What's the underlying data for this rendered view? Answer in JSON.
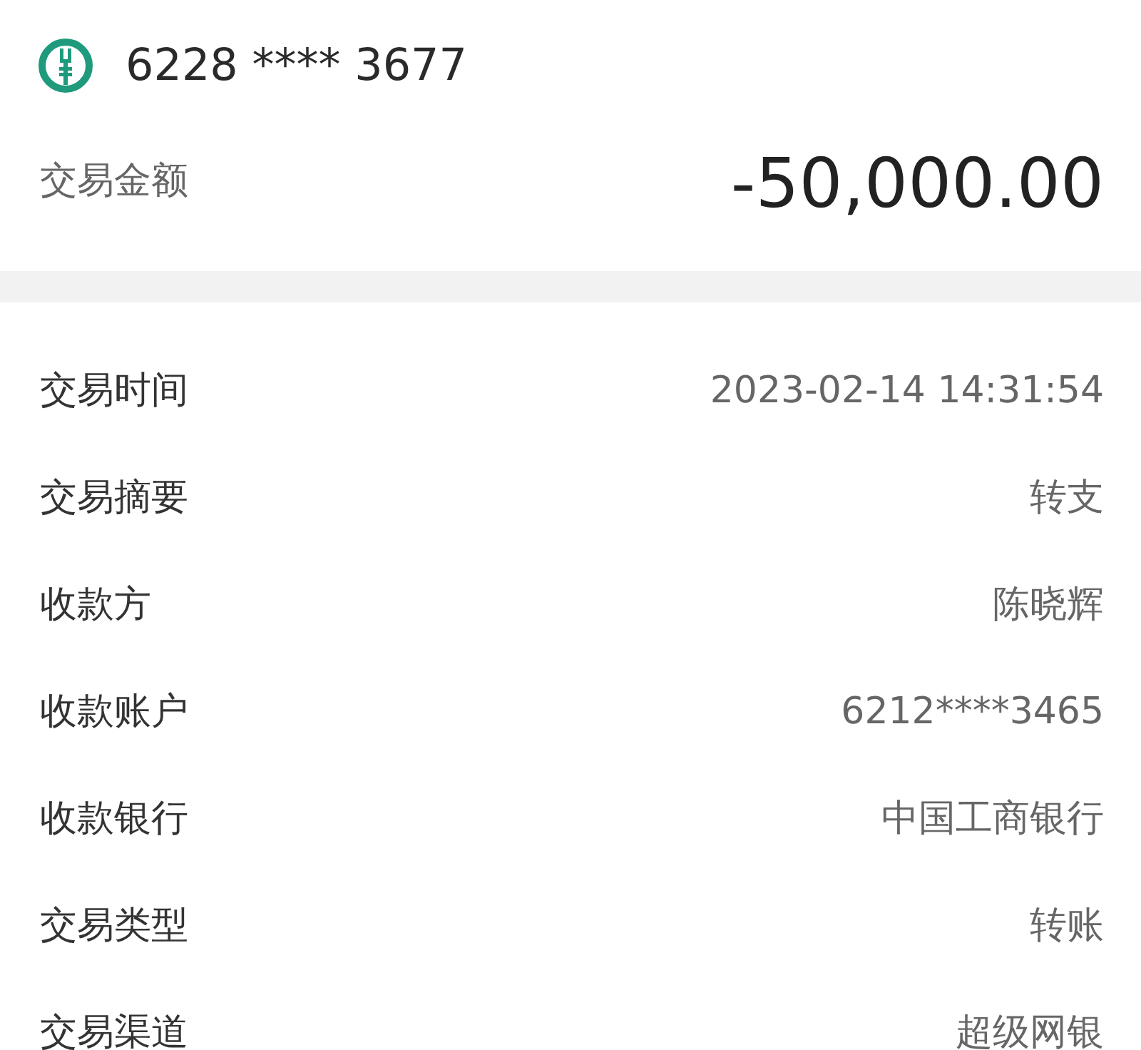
{
  "account": {
    "card_number": "6228 **** 3677"
  },
  "amount": {
    "label": "交易金额",
    "value": "-50,000.00"
  },
  "details": [
    {
      "label": "交易时间",
      "value": "2023-02-14 14:31:54"
    },
    {
      "label": "交易摘要",
      "value": "转支"
    },
    {
      "label": "收款方",
      "value": "陈晓辉"
    },
    {
      "label": "收款账户",
      "value": "6212****3465"
    },
    {
      "label": "收款银行",
      "value": "中国工商银行"
    },
    {
      "label": "交易类型",
      "value": "转账"
    },
    {
      "label": "交易渠道",
      "value": "超级网银"
    }
  ]
}
